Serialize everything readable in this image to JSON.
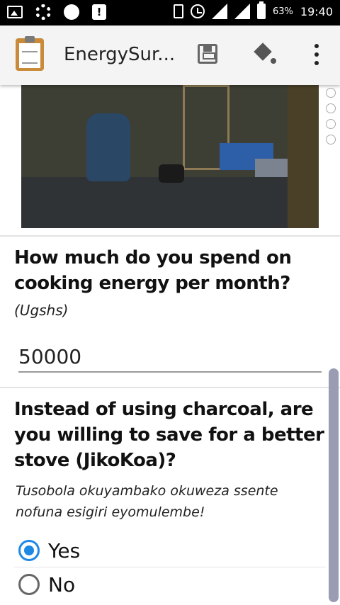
{
  "status_bar": {
    "battery": "63%",
    "time": "19:40"
  },
  "app_bar": {
    "title": "EnergySur..."
  },
  "icons": {
    "app_logo": "clipboard-icon",
    "save": "save-icon",
    "finalize": "finalize-arrow-icon",
    "menu": "more-vert-icon"
  },
  "form": {
    "q1": {
      "label": "How much do you spend on cooking energy per month?",
      "hint": "(Ugshs)",
      "value": "50000"
    },
    "q2": {
      "label": "Instead of using charcoal, are you willing to save for a better stove (JikoKoa)?",
      "hint": "Tusobola okuyambako okuweza ssente nofuna esigiri eyomulembe!",
      "options": [
        {
          "label": "Yes",
          "selected": true
        },
        {
          "label": "No",
          "selected": false
        }
      ]
    }
  },
  "colors": {
    "accent": "#1e88e5",
    "status_bar": "#000000",
    "app_bar": "#f4f4f4"
  }
}
